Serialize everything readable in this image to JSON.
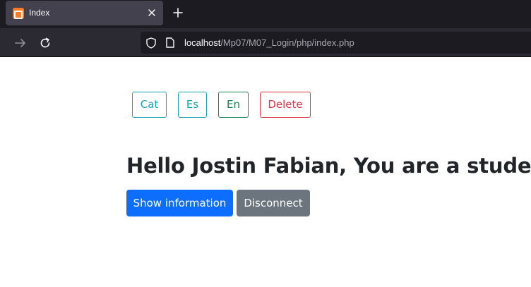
{
  "browser": {
    "tab": {
      "title": "Index",
      "favicon": "xampp-icon"
    },
    "url": {
      "host": "localhost",
      "path": "/Mp07/M07_Login/php/index.php"
    },
    "icons": {
      "close_tab": "close-icon",
      "new_tab": "plus-icon",
      "forward": "arrow-right-icon",
      "reload": "reload-icon",
      "tracking": "shield-icon",
      "page_info": "page-icon"
    },
    "colors": {
      "tabstrip": "#1c1b22",
      "active_tab": "#42414d",
      "toolbar": "#2b2a33"
    }
  },
  "page": {
    "language_buttons": [
      {
        "label": "Cat",
        "color": "#17a2b8"
      },
      {
        "label": "Es",
        "color": "#17a2b8"
      },
      {
        "label": "En",
        "color": "#198754"
      }
    ],
    "delete_label": "Delete",
    "delete_color": "#dc3545",
    "greeting": "Hello Jostin Fabian, You are a student",
    "show_info_label": "Show information",
    "show_info_color": "#0d6efd",
    "disconnect_label": "Disconnect",
    "disconnect_color": "#6c757d"
  }
}
